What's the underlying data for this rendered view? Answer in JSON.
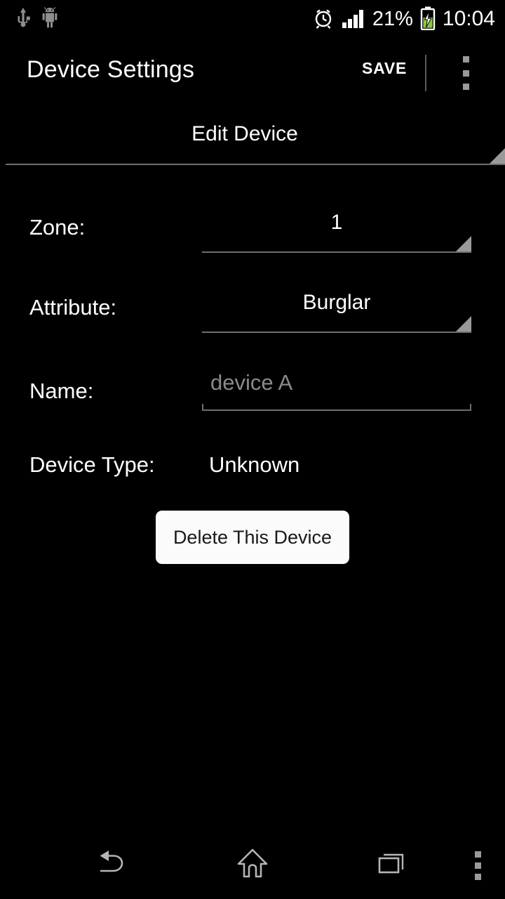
{
  "status_bar": {
    "left_icons": [
      "usb-icon",
      "android-robot-icon"
    ],
    "alarm_icon": "alarm-clock-icon",
    "signal_icon": "signal-bars-icon",
    "battery_percent": "21%",
    "battery_icon": "battery-charging-icon",
    "clock": "10:04"
  },
  "action_bar": {
    "title": "Device Settings",
    "save_label": "SAVE",
    "overflow_icon": "overflow-menu-icon"
  },
  "page_spinner": {
    "selected": "Edit Device",
    "caret_icon": "dropdown-caret-icon"
  },
  "form": {
    "zone": {
      "label": "Zone:",
      "value": "1"
    },
    "attribute": {
      "label": "Attribute:",
      "value": "Burglar"
    },
    "name": {
      "label": "Name:",
      "value": "",
      "placeholder": "device A"
    },
    "device_type": {
      "label": "Device Type:",
      "value": "Unknown"
    }
  },
  "delete_button": {
    "label": "Delete This Device"
  },
  "nav_bar": {
    "back_icon": "back-arrow-icon",
    "home_icon": "home-icon",
    "recents_icon": "recents-icon",
    "menu_icon": "nav-menu-icon"
  },
  "colors": {
    "background": "#000000",
    "text": "#ffffff",
    "muted": "#8a8a8a",
    "divider": "#6e6e6e",
    "caret": "#9a9a9a",
    "button_bg": "#fbfbfb",
    "button_text": "#191919",
    "battery_fill": "#8cc63e"
  }
}
